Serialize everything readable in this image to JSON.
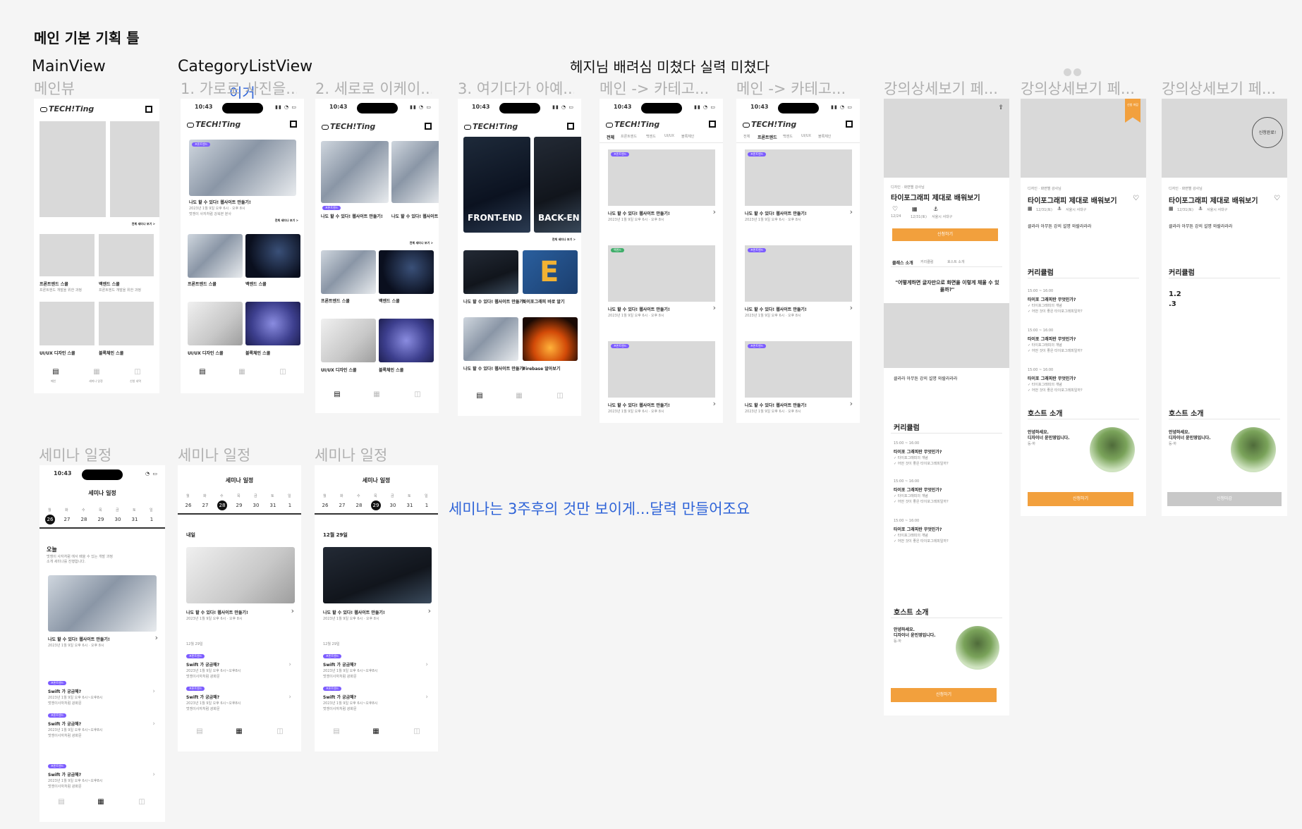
{
  "page": {
    "title": "메인 기본 기획 틀",
    "note_top": "헤지님 배려심 미쳤다 실력 미쳤다",
    "note_seminar": "세미나는 3주후의 것만 보이게...달력 만들어조요",
    "note_igeo": "이거"
  },
  "sections": {
    "main_view": "MainView",
    "category_list_view": "CategoryListView"
  },
  "frame_labels": {
    "f1": "메인뷰",
    "f2": "1. 가로로 사진을...",
    "f3": "2. 세로로 이케이...",
    "f4": "3. 여기다가 아예...",
    "f5": "메인 -> 카테고...",
    "f6": "메인 -> 카테고...",
    "f7": "강의상세보기 페...",
    "f8": "강의상세보기 페...",
    "f9": "강의상세보기 페...",
    "s1": "세미나 일정",
    "s2": "세미나 일정",
    "s3": "세미나 일정"
  },
  "common": {
    "time": "10:43",
    "logo": "TECH!T",
    "logo_suffix": "ing",
    "see_all": "전체 세미나 보기 >",
    "card_title": "나도 할 수 있다! 웹사이트 만들기!",
    "card_date": "2023년 1월 9일 오후 6시 · 오후 8시",
    "card_host": "멋쟁이 사자처럼 강북본 분사",
    "cat_front": "프론트엔드 스쿨",
    "cat_back": "백엔드 스쿨",
    "cat_uiux": "UI/UX 디자인 스쿨",
    "cat_block": "블록체인 스쿨",
    "cat_desc": "프론트엔드 개발을 위한 과정",
    "nav_main": "메인",
    "nav_seminar": "세미나 일정",
    "nav_apply": "신청 내역",
    "badge_front": "프론트엔드",
    "badge_back": "백엔드"
  },
  "frame4": {
    "hero1": "FRONT-END",
    "hero2": "BACK-EN",
    "item3": "타이포그래피 바로 알기",
    "item4": "Firebase 알아보기"
  },
  "category": {
    "tabs": [
      "전체",
      "프론트엔드",
      "백엔드",
      "UI/UX",
      "블록체인"
    ]
  },
  "detail": {
    "meta": "디자인 · 화면별 강사님",
    "title": "타이포그래피 제대로 배워보기",
    "apply": "신청하기",
    "apply_closed": "신청마감",
    "tab1": "클래스 소개",
    "tab2": "커리큘럼",
    "tab3": "호스트 소개",
    "quote": "\"어떻게하면 글자만으로 화면을 이렇게 채울 수 있을까?\"",
    "desc": "클라라 아무튼 강의 설명 와랄라라라",
    "curriculum": "커리큘럼",
    "cur_time1": "15:00 ~ 16:00",
    "cur_item": "타이포 그래피란 무엇인가?",
    "cur_sub1": "✓ 타이포그래피의 개념",
    "cur_sub2": "✓ 어떤 것이 좋은 타이포그래피일까?",
    "host": "호스트 소개",
    "host_text1": "안녕하세요.",
    "host_text2": "디자이너 윤민영입니다.",
    "host_text3": "등-하",
    "num1": "1.2",
    "num2": ".3",
    "ribbon": "신청\n마감",
    "stamp": "신청완료!",
    "info1": "12/24",
    "info2": "12/31(토)",
    "info3": "서울시 서대구"
  },
  "seminar": {
    "header": "세미나 일정",
    "weekdays": [
      "월",
      "화",
      "수",
      "목",
      "금",
      "토",
      "일"
    ],
    "days": [
      "26",
      "27",
      "28",
      "29",
      "30",
      "31",
      "1"
    ],
    "today": "오늘",
    "tomorrow": "내일",
    "dec29": "12월 29일",
    "date_small": "12월 29일",
    "swift_title": "Swift 가 궁금해?",
    "swift_date": "2023년 1월 9일 오후 6시~오후8시",
    "swift_host": "멋쟁이사자처럼 광화문",
    "today_desc": "멋쟁이 사자처럼 에서 배울 수 있는 개발 과정 소개 세미나를 진행합니다."
  }
}
